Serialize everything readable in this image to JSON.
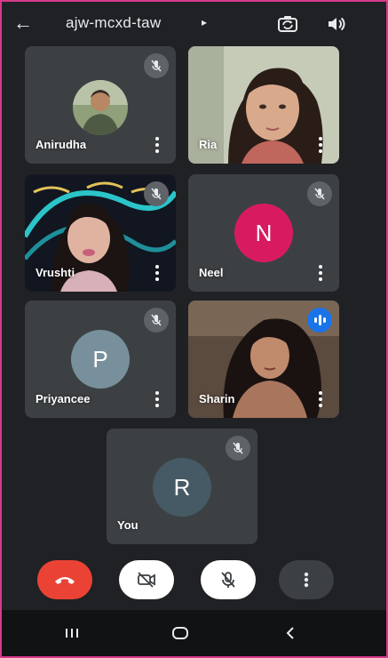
{
  "header": {
    "meeting_code": "ajw-mcxd-taw",
    "caret": "▸",
    "back_icon": "←"
  },
  "participants": [
    {
      "name": "Anirudha",
      "kind": "photo",
      "mic": "muted"
    },
    {
      "name": "Ria",
      "kind": "video",
      "mic": "unmuted"
    },
    {
      "name": "Vrushti",
      "kind": "video",
      "mic": "muted"
    },
    {
      "name": "Neel",
      "kind": "initial",
      "initial": "N",
      "color": "#d81b60",
      "mic": "muted"
    },
    {
      "name": "Priyancee",
      "kind": "initial",
      "initial": "P",
      "color": "#78909c",
      "mic": "muted"
    },
    {
      "name": "Sharin",
      "kind": "video",
      "mic": "speaking",
      "active": true
    },
    {
      "name": "You",
      "kind": "initial",
      "initial": "R",
      "color": "#455a64",
      "mic": "muted"
    }
  ],
  "controls": {
    "end_call_color": "#ea4335",
    "camera": "off",
    "microphone": "off"
  },
  "nav": {
    "recents_icon": "recents-icon",
    "home_icon": "home-icon",
    "back_icon": "back-icon"
  },
  "colors": {
    "background": "#202124",
    "tile": "#3c4043",
    "active_speaker": "#1a73e8",
    "frame_border": "#d63a8a"
  }
}
